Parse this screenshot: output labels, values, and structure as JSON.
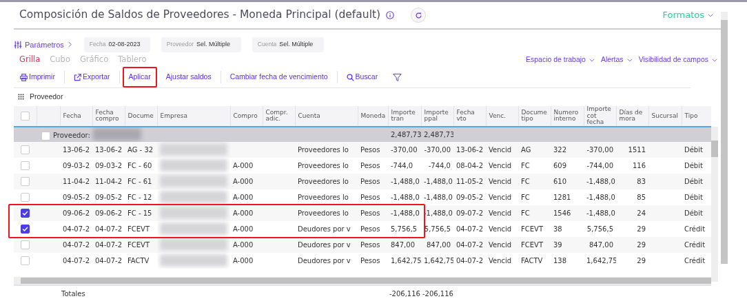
{
  "title": "Composición de Saldos de Proveedores - Moneda Principal (default)",
  "formats_menu": "Formatos",
  "parameters": {
    "label": "Parámetros",
    "chips": [
      {
        "label": "Fecha",
        "value": "02-08-2023"
      },
      {
        "label": "Proveedor",
        "value": "Sel. Múltiple"
      },
      {
        "label": "Cuenta",
        "value": "Sel. Múltiple"
      }
    ]
  },
  "view_tabs": [
    {
      "label": "Grilla",
      "selected": true
    },
    {
      "label": "Cubo",
      "selected": false
    },
    {
      "label": "Gráfico",
      "selected": false
    },
    {
      "label": "Tablero",
      "selected": false
    }
  ],
  "right_menus": [
    "Espacio de trabajo",
    "Alertas",
    "Visibilidad de campos"
  ],
  "toolbar": [
    {
      "kind": "print",
      "label": "Imprimir",
      "highlighted": false
    },
    {
      "kind": "export",
      "label": "Exportar",
      "highlighted": false
    },
    {
      "kind": "plain",
      "label": "Aplicar",
      "highlighted": true
    },
    {
      "kind": "plain",
      "label": "Ajustar saldos",
      "highlighted": false
    },
    {
      "kind": "plain",
      "label": "Cambiar fecha de vencimiento",
      "highlighted": false
    },
    {
      "kind": "search",
      "label": "Buscar",
      "highlighted": false
    },
    {
      "kind": "filter",
      "highlighted": false
    }
  ],
  "group_by": "Proveedor",
  "table": {
    "header_checked": false,
    "columns": [
      "",
      "Fecha",
      "Fecha compro",
      "Docume",
      "Empresa",
      "Compro",
      "Compr. adic.",
      "Cuenta",
      "Moneda",
      "Importe tran",
      "Importe ppal",
      "Fecha vto",
      "Venc.",
      "Docume tipo",
      "Numero interno",
      "Importe cot fecha",
      "Días de mora",
      "Sucursal",
      "Tipo"
    ],
    "group": {
      "label": "Proveedor:",
      "name_blurred": true,
      "checked": false,
      "importe_tran": "2,487,73",
      "importe_ppal": "2,487,73"
    },
    "rows": [
      {
        "checked": false,
        "highlighted": false,
        "empresa_blurred": true,
        "cells": [
          "",
          "13-06-2",
          "13-06-2",
          "AG - 32",
          "",
          "",
          "",
          "Proveedores lo",
          "Pesos",
          "-370,00",
          "-370,00",
          "13-06-2",
          "Vencid",
          "AG",
          "322",
          "-370,00",
          "1511",
          "",
          "Débit"
        ]
      },
      {
        "checked": false,
        "highlighted": false,
        "empresa_blurred": true,
        "cells": [
          "",
          "09-03-2",
          "09-03-2",
          "FC - 60",
          "",
          "A-000",
          "",
          "Proveedores lo",
          "Pesos",
          "-744,0",
          "-744,0",
          "08-04-2",
          "Vencid",
          "FC",
          "609",
          "-744,00",
          "116",
          "",
          "Débit"
        ]
      },
      {
        "checked": false,
        "highlighted": false,
        "empresa_blurred": true,
        "cells": [
          "",
          "11-04-2",
          "11-04-2",
          "FC - 61",
          "",
          "A-000",
          "",
          "Proveedores lo",
          "Pesos",
          "-1,488,0",
          "-1,488,0",
          "11-05-2",
          "Vencid",
          "FC",
          "610",
          "-1,488,0",
          "83",
          "",
          "Débit"
        ]
      },
      {
        "checked": false,
        "highlighted": false,
        "empresa_blurred": true,
        "cells": [
          "",
          "09-05-2",
          "09-05-2",
          "FC - 12",
          "",
          "A-000",
          "",
          "Proveedores lo",
          "Pesos",
          "-1,488,0",
          "-1,488,0",
          "09-05-2",
          "Vencid",
          "FC",
          "1281",
          "-1,488,0",
          "85",
          "",
          "Débit"
        ]
      },
      {
        "checked": true,
        "highlighted": true,
        "empresa_blurred": true,
        "cells": [
          "",
          "09-06-2",
          "09-06-2",
          "FC - 15",
          "",
          "A-000",
          "",
          "Proveedores lo",
          "Pesos",
          "-1,488,0",
          "-1,488,0",
          "09-07-2",
          "Vencid",
          "FC",
          "1546",
          "-1,488,0",
          "24",
          "",
          "Débit"
        ]
      },
      {
        "checked": true,
        "highlighted": true,
        "empresa_blurred": true,
        "cells": [
          "",
          "04-07-2",
          "04-07-2",
          "FCEVT",
          "",
          "A-000",
          "",
          "Deudores por v",
          "Pesos",
          "5,756,5",
          "5,756,5",
          "04-07-2",
          "Vencid",
          "FCEVT",
          "38",
          "5,756,5",
          "29",
          "",
          "Crédit"
        ]
      },
      {
        "checked": false,
        "highlighted": false,
        "empresa_blurred": true,
        "cells": [
          "",
          "04-07-2",
          "04-07-2",
          "FCEVT",
          "",
          "A-000",
          "",
          "Deudores por v",
          "Pesos",
          "847,00",
          "847,00",
          "04-07-2",
          "Vencid",
          "FCEVT",
          "39",
          "847,00",
          "29",
          "",
          "Crédit"
        ]
      },
      {
        "checked": false,
        "highlighted": false,
        "empresa_blurred": true,
        "cells": [
          "",
          "04-07-2",
          "04-07-2",
          "FACTV",
          "",
          "A-000",
          "",
          "Deudores por v",
          "Pesos",
          "1,642,75",
          "1,642,75",
          "04-07-2",
          "Vencid",
          "FACTV",
          "138",
          "1,642,75",
          "29",
          "",
          "Crédit"
        ]
      }
    ],
    "totals": {
      "label": "Totales",
      "importe_tran": "-206,116",
      "importe_ppal": "-206,116"
    }
  }
}
